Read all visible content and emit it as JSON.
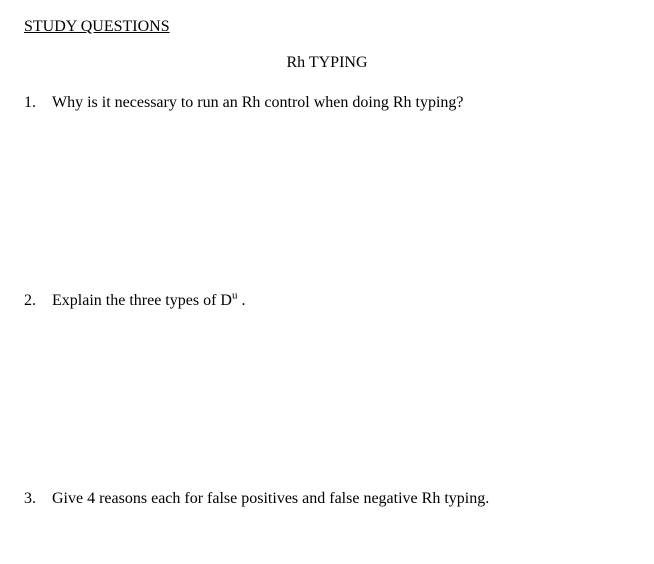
{
  "header": "STUDY QUESTIONS",
  "title": "Rh TYPING",
  "questions": [
    {
      "number": "1.",
      "text": "Why is it necessary to run an Rh control when doing Rh typing?"
    },
    {
      "number": "2.",
      "text_prefix": "Explain the three types of D",
      "text_sup": "u",
      "text_suffix": " ."
    },
    {
      "number": "3.",
      "text": "Give 4 reasons each for false positives and false negative Rh typing."
    }
  ]
}
